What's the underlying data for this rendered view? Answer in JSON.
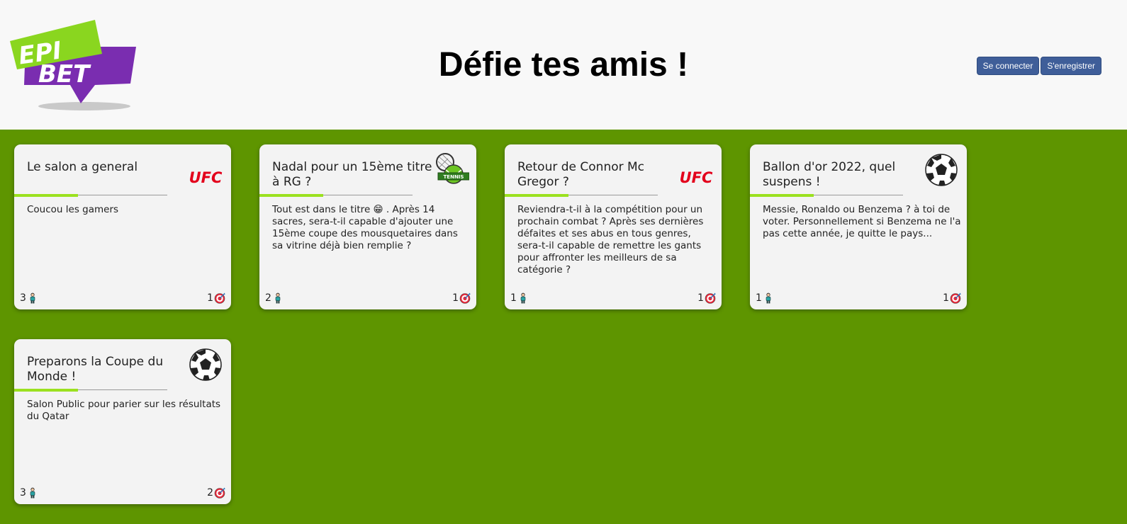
{
  "logo": {
    "line1": "EPI",
    "line2": "BET"
  },
  "header": {
    "title": "Défie tes amis !"
  },
  "auth": {
    "login_label": "Se connecter",
    "register_label": "S'enregistrer"
  },
  "colors": {
    "background": "#5e9500",
    "header_bg": "#f8f8f8",
    "accent": "#9be11f",
    "button": "#3f5e99",
    "ufc_red": "#e3001b"
  },
  "cards": [
    {
      "title": "Le salon a general",
      "icon": "ufc-logo",
      "icon_text": "UFC",
      "description": "Coucou les gamers",
      "members": "3",
      "bets": "1"
    },
    {
      "title": "Nadal pour un 15ème titre à RG ?",
      "icon": "tennis-icon",
      "icon_text": "TENNIS",
      "description": "Tout est dans le titre 😁 . Après 14 sacres, sera-t-il capable d'ajouter une 15ème coupe des mousquetaires dans sa vitrine déjà bien remplie ?",
      "members": "2",
      "bets": "1"
    },
    {
      "title": "Retour de Connor Mc Gregor ?",
      "icon": "ufc-logo",
      "icon_text": "UFC",
      "description": "Reviendra-t-il à la compétition pour un prochain combat ? Après ses dernières défaites et ses abus en tous genres, sera-t-il capable de remettre les gants pour affronter les meilleurs de sa catégorie ?",
      "members": "1",
      "bets": "1"
    },
    {
      "title": "Ballon d'or 2022, quel suspens !",
      "icon": "soccer-ball-icon",
      "description": "Messie, Ronaldo ou Benzema ? à toi de voter. Personnellement si Benzema ne l'a pas cette année, je quitte le pays...",
      "members": "1",
      "bets": "1"
    },
    {
      "title": "Preparons la Coupe du Monde !",
      "icon": "soccer-ball-icon",
      "description": "Salon Public pour parier sur les résultats du Qatar",
      "members": "3",
      "bets": "2"
    }
  ]
}
